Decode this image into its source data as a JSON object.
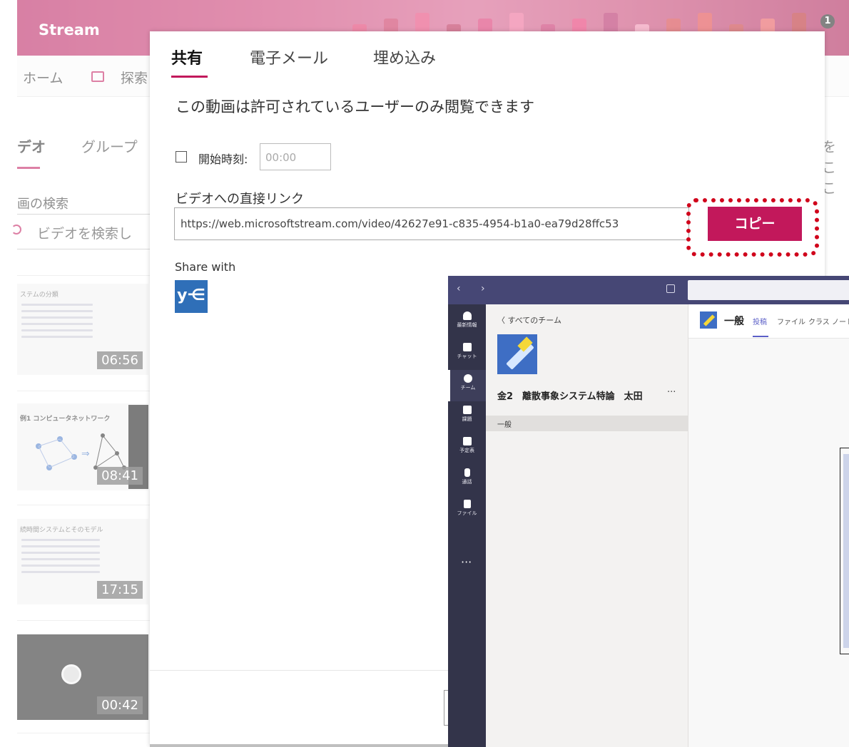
{
  "stream": {
    "logo": "Stream",
    "notification_count": "1",
    "nav": {
      "home": "ホーム",
      "explore": "探索"
    },
    "tabs": {
      "video": "デオ",
      "group": "グループ",
      "right_cut": "をここ"
    },
    "search": {
      "label": "画の検索",
      "placeholder": "ビデオを検索し"
    },
    "videos": [
      {
        "title": "ステムの分類",
        "duration": "06:56"
      },
      {
        "title": "例1 コンピュータネットワーク",
        "duration": "08:41"
      },
      {
        "title": "続時間システムとそのモデル",
        "duration": "17:15"
      },
      {
        "title": "",
        "duration": "00:42"
      }
    ]
  },
  "dialog": {
    "tabs": [
      {
        "label": "共有",
        "active": true
      },
      {
        "label": "電子メール",
        "active": false
      },
      {
        "label": "埋め込み",
        "active": false
      }
    ],
    "description": "この動画は許可されているユーザーのみ閲覧できます",
    "start_time": {
      "label": "開始時刻:",
      "placeholder": "00:00",
      "checked": false
    },
    "direct_link": {
      "label": "ビデオへの直接リンク",
      "url": "https://web.microsoftstream.com/video/42627e91-c835-4954-b1a0-ea79d28ffc53"
    },
    "copy_button": "コピー",
    "share_with": "Share with",
    "share_targets": [
      {
        "name": "yammer-icon",
        "glyph": "y⋲"
      }
    ],
    "accent_color": "#c2185b",
    "highlight_color": "#d0021b"
  },
  "teams": {
    "rail": [
      {
        "label": "最新情報",
        "icon": "bell-icon"
      },
      {
        "label": "チャット",
        "icon": "chat-icon"
      },
      {
        "label": "チーム",
        "icon": "teams-icon",
        "active": true
      },
      {
        "label": "課題",
        "icon": "assignment-icon"
      },
      {
        "label": "予定表",
        "icon": "calendar-icon"
      },
      {
        "label": "通話",
        "icon": "phone-icon"
      },
      {
        "label": "ファイル",
        "icon": "file-icon"
      }
    ],
    "rail_more": "···",
    "back_link": "〈 すべてのチーム",
    "team_name": "金2　離散事象システム特論　太田",
    "team_more": "···",
    "channel": "一般",
    "content": {
      "title": "一般",
      "tabs": [
        {
          "label": "投稿",
          "active": true
        },
        {
          "label": "ファイル",
          "active": false
        },
        {
          "label": "クラス ノートブ",
          "active": false
        }
      ]
    }
  }
}
